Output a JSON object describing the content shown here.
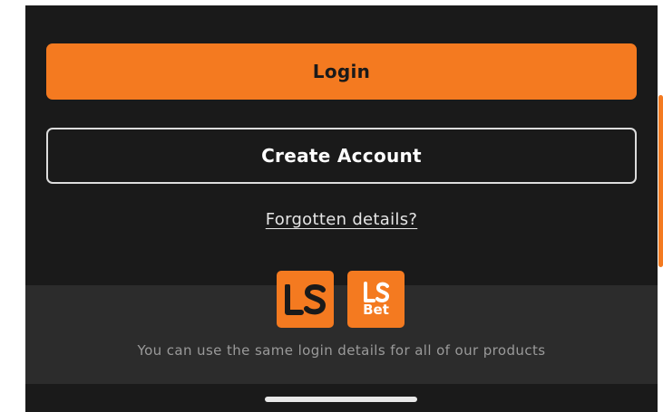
{
  "auth": {
    "login_label": "Login",
    "create_account_label": "Create Account",
    "forgotten_label": "Forgotten details?"
  },
  "products": {
    "logos": [
      {
        "name": "LS"
      },
      {
        "name": "LS Bet",
        "subtext": "Bet"
      }
    ],
    "note": "You can use the same login details for all of our products"
  },
  "colors": {
    "accent": "#f47a20",
    "background": "#1a1a1a",
    "band": "#2c2c2c"
  }
}
